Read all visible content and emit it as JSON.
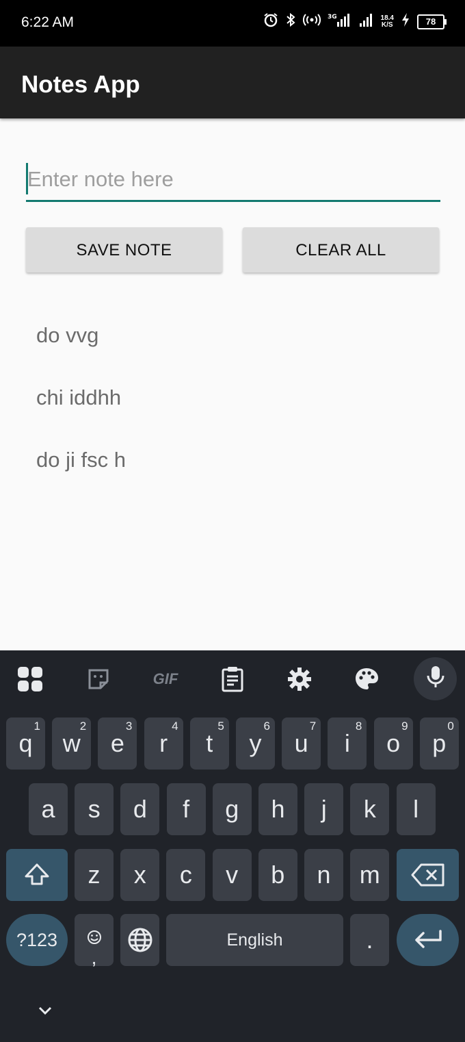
{
  "status": {
    "time": "6:22 AM",
    "battery": "78",
    "net_speed_top": "18.4",
    "net_speed_bottom": "K/S",
    "network_label": "3G"
  },
  "app": {
    "title": "Notes App"
  },
  "input": {
    "placeholder": "Enter note here"
  },
  "buttons": {
    "save": "SAVE NOTE",
    "clear": "CLEAR ALL"
  },
  "notes": [
    "do vvg",
    "chi iddhh",
    "do ji fsc h"
  ],
  "keyboard": {
    "row1": [
      {
        "k": "q",
        "h": "1"
      },
      {
        "k": "w",
        "h": "2"
      },
      {
        "k": "e",
        "h": "3"
      },
      {
        "k": "r",
        "h": "4"
      },
      {
        "k": "t",
        "h": "5"
      },
      {
        "k": "y",
        "h": "6"
      },
      {
        "k": "u",
        "h": "7"
      },
      {
        "k": "i",
        "h": "8"
      },
      {
        "k": "o",
        "h": "9"
      },
      {
        "k": "p",
        "h": "0"
      }
    ],
    "row2": [
      "a",
      "s",
      "d",
      "f",
      "g",
      "h",
      "j",
      "k",
      "l"
    ],
    "row3": [
      "z",
      "x",
      "c",
      "v",
      "b",
      "n",
      "m"
    ],
    "symbols": "?123",
    "comma": ",",
    "space": "English",
    "period": ".",
    "toolbar_gif": "GIF"
  },
  "colors": {
    "accent": "#137a70",
    "appbar": "#212121",
    "keyboard_bg": "#202329",
    "key_bg": "#3b3f47",
    "key_action": "#36566a"
  }
}
